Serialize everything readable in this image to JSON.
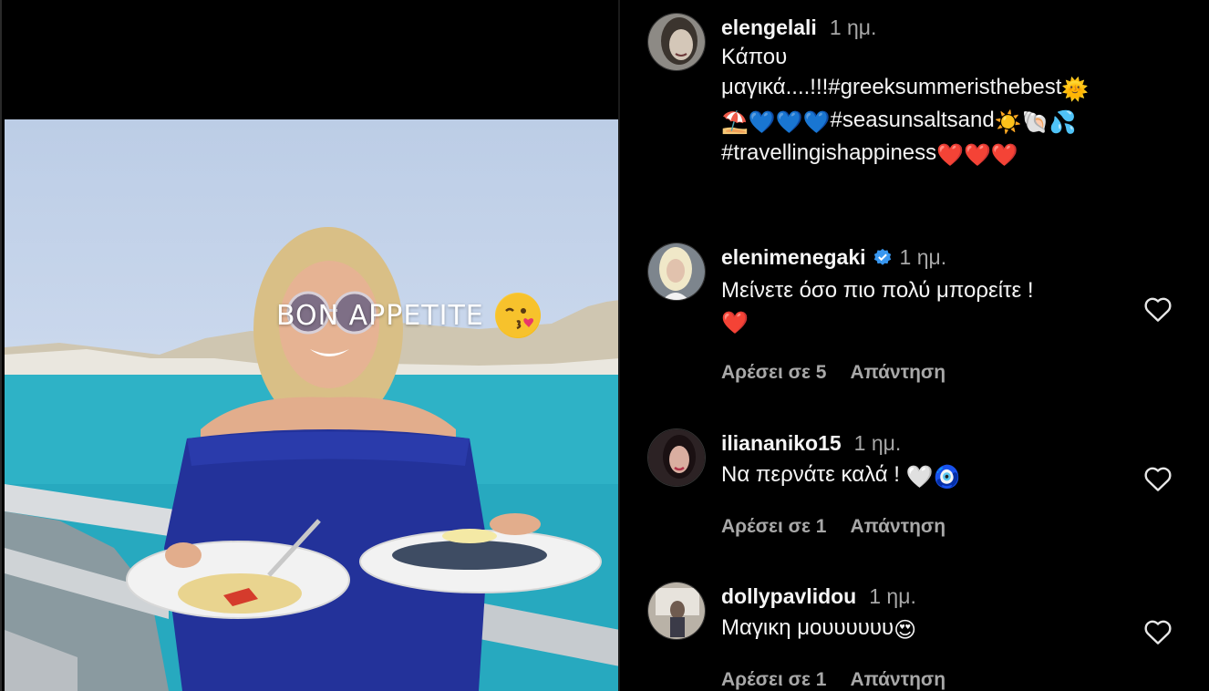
{
  "post": {
    "overlay_text": "BON APPETITE"
  },
  "comments": [
    {
      "username": "elengelali",
      "time": "1 ημ.",
      "verified": false,
      "text_line1": "Κάπου",
      "text_line2": "μαγικά....!!!#greeksummeristhebest",
      "text_line3": "#seasunsaltsand",
      "text_line4": "#travellingishappiness"
    },
    {
      "username": "elenimenegaki",
      "time": "1 ημ.",
      "verified": true,
      "text": "Μείνετε όσο πιο πολύ μπορείτε !",
      "likes_label": "Αρέσει σε 5",
      "reply_label": "Απάντηση"
    },
    {
      "username": "iliananiko15",
      "time": "1 ημ.",
      "verified": false,
      "text": "Να περνάτε καλά !",
      "likes_label": "Αρέσει σε 1",
      "reply_label": "Απάντηση"
    },
    {
      "username": "dollypavlidou",
      "time": "1 ημ.",
      "verified": false,
      "text": "Μαγικη μουυυυυυ",
      "likes_label": "Αρέσει σε 1",
      "reply_label": "Απάντηση"
    }
  ],
  "colors": {
    "background": "#000000",
    "text_primary": "#f5f5f5",
    "text_secondary": "#a8a8a8",
    "verified_blue": "#3897f0",
    "heart_red": "#ed4956"
  }
}
